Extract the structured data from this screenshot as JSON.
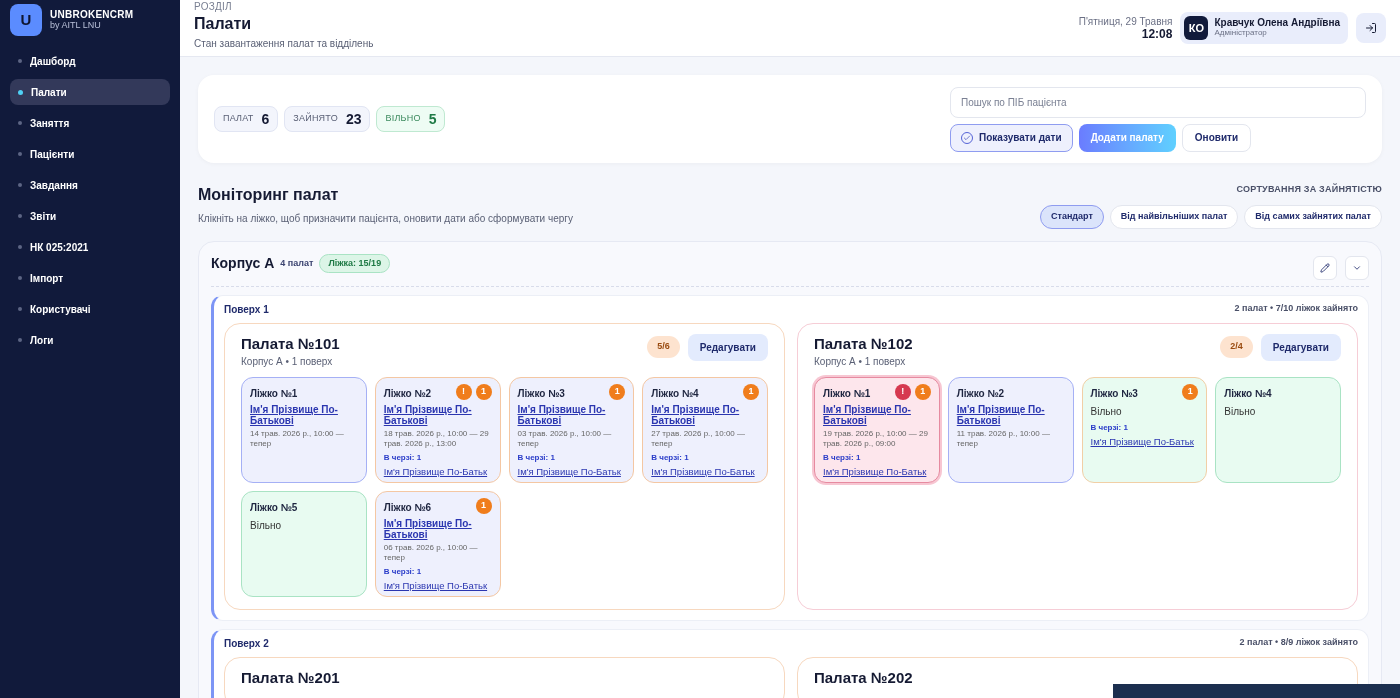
{
  "sidebar": {
    "logo": "U",
    "brand": "UNBROKENCRM",
    "brand_sub": "by AITL LNU",
    "items": [
      {
        "label": "Дашборд",
        "selected": false
      },
      {
        "label": "Палати",
        "selected": true
      },
      {
        "label": "Заняття",
        "selected": false
      },
      {
        "label": "Пацієнти",
        "selected": false
      },
      {
        "label": "Завдання",
        "selected": false
      },
      {
        "label": "Звіти",
        "selected": false
      },
      {
        "label": "НК 025:2021",
        "selected": false
      },
      {
        "label": "Імпорт",
        "selected": false
      },
      {
        "label": "Користувачі",
        "selected": false
      },
      {
        "label": "Логи",
        "selected": false
      }
    ]
  },
  "header": {
    "eyebrow": "РОЗДІЛ",
    "title": "Палати",
    "subtitle": "Стан завантаження палат та відділень",
    "date": "П'ятниця, 29 Травня",
    "time": "12:08",
    "user": {
      "initials": "КО",
      "name": "Кравчук Олена Андріївна",
      "role": "Адміністратор"
    }
  },
  "stats": [
    {
      "label": "ПАЛАТ",
      "value": "6",
      "kind": "neutral"
    },
    {
      "label": "ЗАЙНЯТО",
      "value": "23",
      "kind": "neutral"
    },
    {
      "label": "ВІЛЬНО",
      "value": "5",
      "kind": "free"
    }
  ],
  "search": {
    "placeholder": "Пошук по ПІБ пацієнта"
  },
  "show_dates": {
    "label": "Показувати дати",
    "checked": true
  },
  "add_button": "Додати палату",
  "refresh_button": "Оновити",
  "monitoring": {
    "title": "Моніторинг палат",
    "hint": "Клікніть на ліжко, щоб призначити пацієнта, оновити дати або сформувати чергу",
    "sort_label": "СОРТУВАННЯ ЗА ЗАЙНЯТІСТЮ",
    "sort_options": [
      {
        "label": "Стандарт",
        "selected": true
      },
      {
        "label": "Від найвільніших палат",
        "selected": false
      },
      {
        "label": "Від самих зайнятих палат",
        "selected": false
      }
    ]
  },
  "buildings": [
    {
      "name": "Корпус А",
      "count": "4 палат",
      "beds": "Ліжка: 15/19",
      "floors": [
        {
          "name": "Поверх 1",
          "summary": "2 палат • 7/10 ліжок зайнято",
          "wards": [
            {
              "title": "Палата №101",
              "subtitle": "Корпус А • 1 поверх",
              "occupancy": "5/6",
              "edit": "Редагувати",
              "beds": [
                {
                  "label": "Ліжко №1",
                  "kind": "occupied",
                  "patient": "Ім'я Прізвище По-Батькові",
                  "dates": "14 трав. 2026 р., 10:00 — тепер"
                },
                {
                  "label": "Ліжко №2",
                  "kind": "queued",
                  "patient": "Ім'я Прізвище По-Батькові",
                  "dates": "18 трав. 2026 р., 10:00 — 29 трав. 2026 р., 13:00",
                  "queue": "В черзі: 1",
                  "queue_patient": "Ім'я Прізвище По-Батьк",
                  "badges": [
                    {
                      "kind": "warning",
                      "text": "!"
                    },
                    {
                      "kind": "queue",
                      "text": "1"
                    }
                  ]
                },
                {
                  "label": "Ліжко №3",
                  "kind": "queued",
                  "patient": "Ім'я Прізвище По-Батькові",
                  "dates": "03 трав. 2026 р., 10:00 — тепер",
                  "queue": "В черзі: 1",
                  "queue_patient": "Ім'я Прізвище По-Батьк",
                  "badges": [
                    {
                      "kind": "queue",
                      "text": "1"
                    }
                  ]
                },
                {
                  "label": "Ліжко №4",
                  "kind": "queued",
                  "patient": "Ім'я Прізвище По-Батькові",
                  "dates": "27 трав. 2026 р., 10:00 — тепер",
                  "queue": "В черзі: 1",
                  "queue_patient": "Ім'я Прізвище По-Батьк",
                  "badges": [
                    {
                      "kind": "queue",
                      "text": "1"
                    }
                  ]
                },
                {
                  "label": "Ліжко №5",
                  "kind": "free",
                  "status": "Вільно"
                },
                {
                  "label": "Ліжко №6",
                  "kind": "queued",
                  "patient": "Ім'я Прізвище По-Батькові",
                  "dates": "06 трав. 2026 р., 10:00 — тепер",
                  "queue": "В черзі: 1",
                  "queue_patient": "Ім'я Прізвище По-Батьк",
                  "badges": [
                    {
                      "kind": "queue",
                      "text": "1"
                    }
                  ]
                }
              ]
            },
            {
              "title": "Палата №102",
              "subtitle": "Корпус А • 1 поверх",
              "occupancy": "2/4",
              "edit": "Редагувати",
              "beds": [
                {
                  "label": "Ліжко №1",
                  "kind": "overdue",
                  "patient": "Ім'я Прізвище По-Батькові",
                  "dates": "19 трав. 2026 р., 10:00 — 29 трав. 2026 р., 09:00",
                  "queue": "В черзі: 1",
                  "queue_patient": "Ім'я Прізвище По-Батьк",
                  "badges": [
                    {
                      "kind": "danger",
                      "text": "!"
                    },
                    {
                      "kind": "queue",
                      "text": "1"
                    }
                  ]
                },
                {
                  "label": "Ліжко №2",
                  "kind": "occupied",
                  "patient": "Ім'я Прізвище По-Батькові",
                  "dates": "11 трав. 2026 р., 10:00 — тепер"
                },
                {
                  "label": "Ліжко №3",
                  "kind": "free_queued",
                  "status": "Вільно",
                  "queue": "В черзі: 1",
                  "queue_patient": "Ім'я Прізвище По-Батьк",
                  "badges": [
                    {
                      "kind": "queue",
                      "text": "1"
                    }
                  ]
                },
                {
                  "label": "Ліжко №4",
                  "kind": "free",
                  "status": "Вільно"
                }
              ]
            }
          ]
        },
        {
          "name": "Поверх 2",
          "summary": "2 палат • 8/9 ліжок зайнято",
          "wards": [
            {
              "title": "Палата №201"
            },
            {
              "title": "Палата №202"
            }
          ]
        }
      ]
    }
  ]
}
